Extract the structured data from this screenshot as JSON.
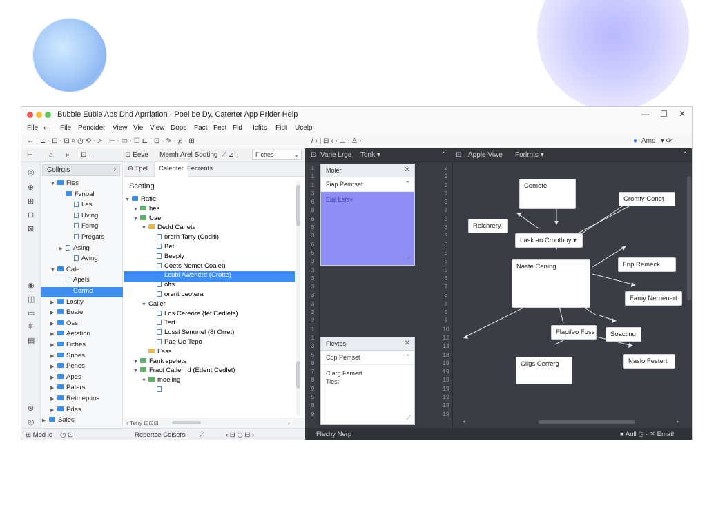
{
  "window": {
    "title": "Bubble Euble  Aps Dnd Aprriation · Poel be Dy, Caterter  App Prider Help",
    "controls": [
      "—",
      "☐",
      "✕"
    ]
  },
  "menubar": [
    "File",
    "‹·",
    "File",
    "Pencider",
    "View",
    "Vie",
    "View",
    "Dops",
    "Fact",
    "Fect",
    "Fid",
    "Icfits",
    "Fidt",
    "Ucelp"
  ],
  "toolbar": {
    "left": "← · ⊏ · ⊡ · ⊡ ⌕ ◷  ⟲ · ≻ · ⊢ · ▭ · ☐  ⊏ · ⊡ · ✎ · ℘ · ⊞",
    "mid": "/ ›  |  ⊟ ‹ ›   ⊥ ·  ♙ ·",
    "right_label": "Amd",
    "right_extra": "▾   ⟳ ·"
  },
  "left_header": {
    "items": [
      "⊢",
      "⌂",
      "»",
      "⊡ ·",
      "⊡ Eeve",
      "Memh Arel Sooting",
      "⟋ ⊿ ·"
    ],
    "dropdown": "Fiches"
  },
  "sidebar_icons": [
    "◎",
    "⊕",
    "⊞",
    "⊟",
    "⊠",
    "◉",
    "◫",
    "▭",
    "⎈",
    "▤",
    "⊛",
    "◴"
  ],
  "explorer": {
    "header": "Collrgis",
    "items": [
      {
        "label": "Fies",
        "indent": 0,
        "caret": "▼",
        "kind": "folder"
      },
      {
        "label": "Fsnoal",
        "indent": 1,
        "caret": "",
        "kind": "folder"
      },
      {
        "label": "Les",
        "indent": 2,
        "caret": "",
        "kind": "file"
      },
      {
        "label": "Uving",
        "indent": 2,
        "caret": "",
        "kind": "file"
      },
      {
        "label": "Fomg",
        "indent": 2,
        "caret": "",
        "kind": "file"
      },
      {
        "label": "Pregars",
        "indent": 2,
        "caret": "",
        "kind": "file"
      },
      {
        "label": "Asing",
        "indent": 1,
        "caret": "▶",
        "kind": "file"
      },
      {
        "label": "Aving",
        "indent": 2,
        "caret": "",
        "kind": "file"
      },
      {
        "label": "Cale",
        "indent": 0,
        "caret": "▼",
        "kind": "folder"
      },
      {
        "label": "Apels",
        "indent": 1,
        "caret": "",
        "kind": "file"
      },
      {
        "label": "Corme",
        "indent": 1,
        "caret": "",
        "kind": "file",
        "selected": true
      },
      {
        "label": "Losity",
        "indent": 0,
        "caret": "▶",
        "kind": "folder"
      },
      {
        "label": "Eoale",
        "indent": 0,
        "caret": "▶",
        "kind": "folder"
      },
      {
        "label": "Oss",
        "indent": 0,
        "caret": "▶",
        "kind": "folder"
      },
      {
        "label": "Aetation",
        "indent": 0,
        "caret": "▶",
        "kind": "folder"
      },
      {
        "label": "Fiches",
        "indent": 0,
        "caret": "▶",
        "kind": "folder"
      },
      {
        "label": "Snoes",
        "indent": 0,
        "caret": "▶",
        "kind": "folder"
      },
      {
        "label": "Penes",
        "indent": 0,
        "caret": "▶",
        "kind": "folder"
      },
      {
        "label": "Apes",
        "indent": 0,
        "caret": "▶",
        "kind": "folder"
      },
      {
        "label": "Paters",
        "indent": 0,
        "caret": "▶",
        "kind": "folder"
      },
      {
        "label": "Retmeptins",
        "indent": 0,
        "caret": "▶",
        "kind": "folder"
      },
      {
        "label": "Pdes",
        "indent": 0,
        "caret": "▶",
        "kind": "folder"
      },
      {
        "label": "Sales",
        "indent": -1,
        "caret": "▶",
        "kind": "folder"
      }
    ]
  },
  "middle": {
    "tabs": [
      "⊜ Tpel",
      "Calenter",
      "Fecrents"
    ],
    "title": "Sceting",
    "tree": [
      {
        "label": "Ratie",
        "indent": 0,
        "caret": "▼",
        "kind": "folder"
      },
      {
        "label": "hes",
        "indent": 1,
        "caret": "▼",
        "kind": "gfolder"
      },
      {
        "label": "Uae",
        "indent": 1,
        "caret": "▼",
        "kind": "gfolder"
      },
      {
        "label": "Dedd Carlets",
        "indent": 2,
        "caret": "▼",
        "kind": "yfolder"
      },
      {
        "label": "orerh Tarry (Coditi)",
        "indent": 3,
        "caret": "",
        "kind": "file"
      },
      {
        "label": "Bet",
        "indent": 3,
        "caret": "",
        "kind": "file"
      },
      {
        "label": "Beeply",
        "indent": 3,
        "caret": "",
        "kind": "file"
      },
      {
        "label": "Coets Nemet Coalet)",
        "indent": 3,
        "caret": "",
        "kind": "file"
      },
      {
        "label": "Lcubi Awenerd (Crotte)",
        "indent": 3,
        "caret": "",
        "kind": "file",
        "selected": true
      },
      {
        "label": "ofts",
        "indent": 3,
        "caret": "",
        "kind": "file"
      },
      {
        "label": "orerit Leotera",
        "indent": 3,
        "caret": "",
        "kind": "file"
      },
      {
        "label": "Calier",
        "indent": 2,
        "caret": "▼",
        "kind": "none"
      },
      {
        "label": "Los Cereore (fet Cedlets)",
        "indent": 3,
        "caret": "",
        "kind": "file"
      },
      {
        "label": "Tert",
        "indent": 3,
        "caret": "",
        "kind": "file"
      },
      {
        "label": "Lossl Senurtel (8t Orret)",
        "indent": 3,
        "caret": "",
        "kind": "file"
      },
      {
        "label": "Pae Ue Tepo",
        "indent": 3,
        "caret": "",
        "kind": "file"
      },
      {
        "label": "Fass",
        "indent": 2,
        "caret": "",
        "kind": "yfolder"
      },
      {
        "label": "Fank spelets",
        "indent": 1,
        "caret": "▼",
        "kind": "gfolder"
      },
      {
        "label": "Fract Catler rd (Edent Cedlet)",
        "indent": 1,
        "caret": "▼",
        "kind": "gfolder"
      },
      {
        "label": "moeling",
        "indent": 2,
        "caret": "▼",
        "kind": "gfolder"
      },
      {
        "label": "",
        "indent": 3,
        "caret": "",
        "kind": "file"
      }
    ],
    "hscroll": [
      "‹  Teny  ⊡⊡⊡",
      "›"
    ]
  },
  "dark": {
    "header_left": [
      "⊡",
      "Varie Lrge",
      "Tonk ▾",
      "⌃"
    ],
    "header_right": [
      "⊡",
      "Apple Viwe",
      "Forlrnts ▾",
      "⌃"
    ],
    "gutter_left": [
      "1",
      "1",
      "1",
      "3",
      "6",
      "8",
      "6",
      "5",
      "3",
      "6",
      "5",
      "3",
      "3",
      "3",
      "3",
      "3",
      "3",
      "2",
      "2",
      "1",
      "1",
      "3",
      "5",
      "8",
      "7",
      "8",
      "9",
      "5",
      "8",
      "9"
    ],
    "gutter_right": [
      "2",
      "2",
      "2",
      "3",
      "3",
      "3",
      "3",
      "3",
      "5",
      "6",
      "5",
      "5",
      "5",
      "6",
      "7",
      "3",
      "3",
      "5",
      "9",
      "10",
      "12",
      "13",
      "18",
      "19",
      "19",
      "19",
      "19",
      "19",
      "19",
      "19"
    ],
    "card1": {
      "header": "Molerl",
      "close": "✕",
      "section": "Fiap Pemrset",
      "body": "Eial Lsfay"
    },
    "card2": {
      "header": "Fievtes",
      "close": "✕",
      "section": "Cop Pemset",
      "body": [
        "Clarg Femert",
        "Tiest"
      ]
    },
    "nodes": {
      "n_top": "Comete",
      "n_right1": "Cromty Conet",
      "n_left": "Reichrery",
      "n_hub": "Lask an Croothoy ▾",
      "n_center": "Naste Cening",
      "n_right2": "Frip Remeck",
      "n_right3": "Famy Nernenert",
      "n_bottom": "Flacifeo Foss",
      "n_spacing": "Soacting",
      "n_bl": "Cligs Cerrerg",
      "n_br": "Naslo Festert"
    }
  },
  "status": {
    "left1": "⊞ Mod ic",
    "left2": "◷  ⊡",
    "left3": "Repertse Colsers",
    "left4": "⟋",
    "left5": "‹    ⊟   ◷   ⊟   ›",
    "right1": "Flechy Nerp",
    "right2": "■ Aull  ◷ · ✕ Ematl"
  },
  "colors": {
    "accent": "#3d8ef0",
    "dark_bg": "#3a3d43",
    "purple_panel": "#8e8ef4"
  }
}
